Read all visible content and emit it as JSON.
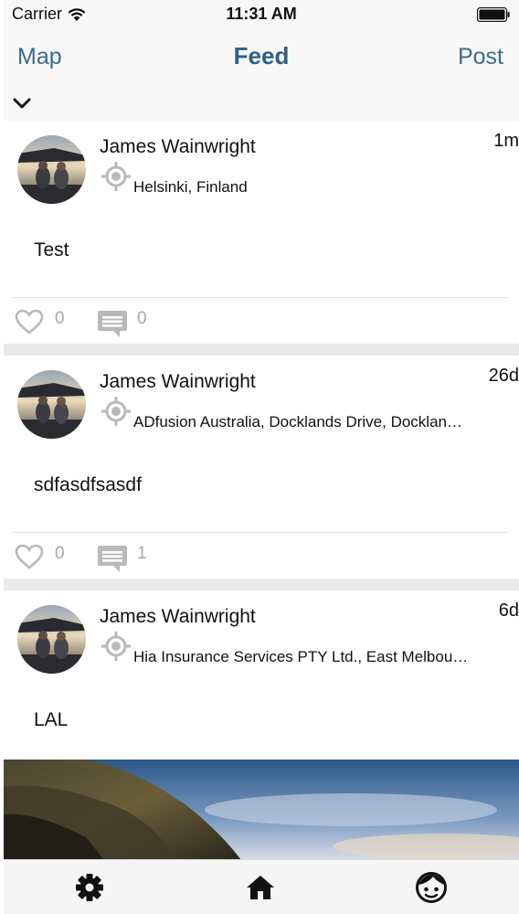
{
  "status_bar": {
    "carrier": "Carrier",
    "time": "11:31 AM"
  },
  "nav": {
    "left_label": "Map",
    "title": "Feed",
    "right_label": "Post"
  },
  "feed": {
    "posts": [
      {
        "author": "James Wainwright",
        "time": "1m",
        "location": "Helsinki, Finland",
        "text": "Test",
        "likes": "0",
        "comments": "0"
      },
      {
        "author": "James Wainwright",
        "time": "26d",
        "location": "ADfusion Australia, Docklands Drive, Docklan…",
        "text": "sdfasdfsasdf",
        "likes": "0",
        "comments": "1"
      },
      {
        "author": "James Wainwright",
        "time": "6d",
        "location": "Hia Insurance Services PTY Ltd., East Melbou…",
        "text": "LAL"
      }
    ]
  },
  "tabs": [
    {
      "icon": "gear-icon"
    },
    {
      "icon": "home-icon"
    },
    {
      "icon": "face-icon"
    }
  ],
  "colors": {
    "nav_accent": "#3a6b8f",
    "nav_title": "#2f5f85",
    "count_gray": "#a7a7aa",
    "icon_gray": "#b9b9bc"
  }
}
